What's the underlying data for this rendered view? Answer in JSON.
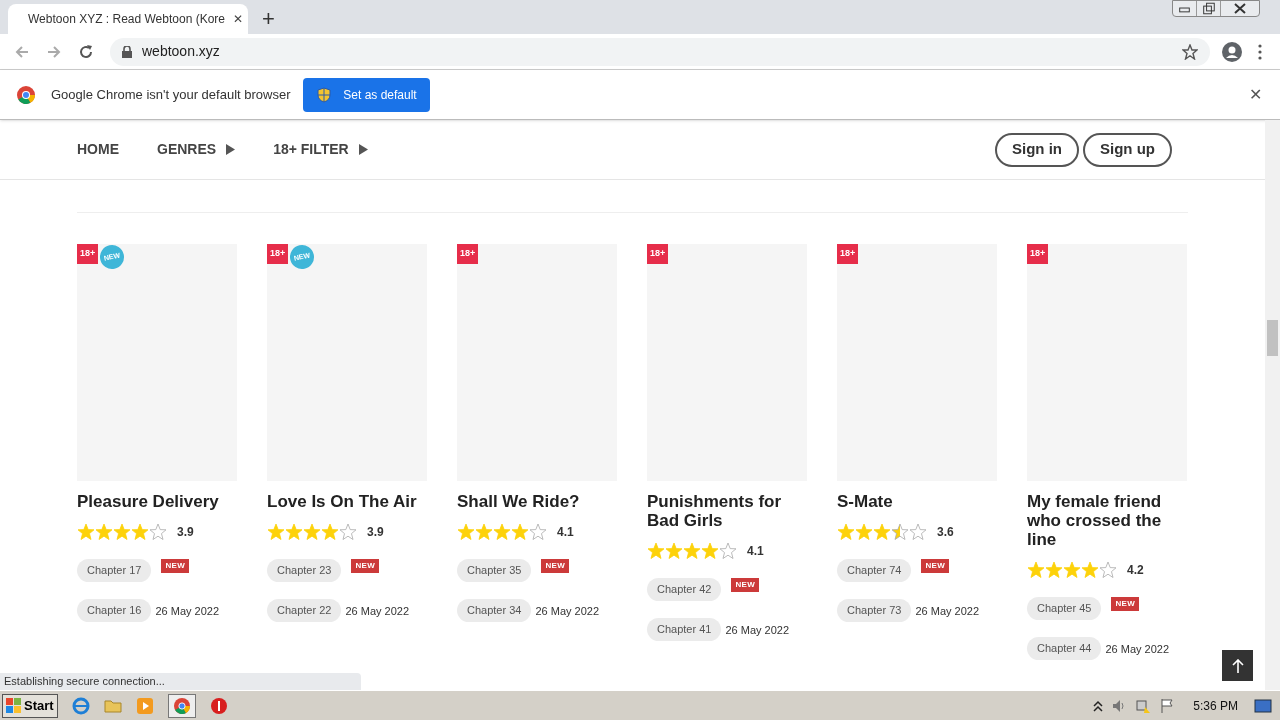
{
  "browser": {
    "tab_title": "Webtoon XYZ : Read Webtoon (Kore",
    "tab_close": "✕",
    "new_tab": "+",
    "url": "webtoon.xyz",
    "infobar": {
      "message": "Google Chrome isn't your default browser",
      "button": "Set as default",
      "close": "✕"
    }
  },
  "nav": {
    "items": [
      {
        "label": "HOME",
        "has_arrow": false
      },
      {
        "label": "GENRES",
        "has_arrow": true
      },
      {
        "label": "18+ FILTER",
        "has_arrow": true
      }
    ],
    "buttons": [
      "Sign in",
      "Sign up"
    ]
  },
  "cards": [
    {
      "title": "Pleasure Delivery",
      "badges": [
        {
          "kind": "age",
          "text": "18+"
        },
        {
          "kind": "new",
          "text": "NEW"
        }
      ],
      "stars": 4,
      "rating": "3.9",
      "chapters": [
        {
          "label": "Chapter 17",
          "tag": "NEW"
        },
        {
          "label": "Chapter 16",
          "date": "26 May 2022"
        }
      ]
    },
    {
      "title": "Love Is On The Air",
      "badges": [
        {
          "kind": "age",
          "text": "18+"
        },
        {
          "kind": "new",
          "text": "NEW"
        }
      ],
      "stars": 4,
      "rating": "3.9",
      "chapters": [
        {
          "label": "Chapter 23",
          "tag": "NEW"
        },
        {
          "label": "Chapter 22",
          "date": "26 May 2022"
        }
      ]
    },
    {
      "title": "Shall We Ride?",
      "badges": [
        {
          "kind": "age",
          "text": "18+"
        }
      ],
      "stars": 4,
      "rating": "4.1",
      "chapters": [
        {
          "label": "Chapter 35",
          "tag": "NEW"
        },
        {
          "label": "Chapter 34",
          "date": "26 May 2022"
        }
      ]
    },
    {
      "title": "Punishments for Bad Girls",
      "badges": [
        {
          "kind": "age",
          "text": "18+"
        }
      ],
      "stars": 4,
      "rating": "4.1",
      "chapters": [
        {
          "label": "Chapter 42",
          "tag": "NEW"
        },
        {
          "label": "Chapter 41",
          "date": "26 May 2022"
        }
      ]
    },
    {
      "title": "S-Mate",
      "badges": [
        {
          "kind": "age",
          "text": "18+"
        }
      ],
      "stars": 3.5,
      "rating": "3.6",
      "chapters": [
        {
          "label": "Chapter 74",
          "tag": "NEW"
        },
        {
          "label": "Chapter 73",
          "date": "26 May 2022"
        }
      ]
    },
    {
      "title": "My female friend who crossed the line",
      "badges": [
        {
          "kind": "age",
          "text": "18+"
        }
      ],
      "stars": 4,
      "rating": "4.2",
      "chapters": [
        {
          "label": "Chapter 45",
          "tag": "NEW"
        },
        {
          "label": "Chapter 44",
          "date": "26 May 2022"
        }
      ]
    }
  ],
  "status_bubble": "Establishing secure connection...",
  "taskbar": {
    "start": "Start",
    "clock": "5:36 PM"
  }
}
